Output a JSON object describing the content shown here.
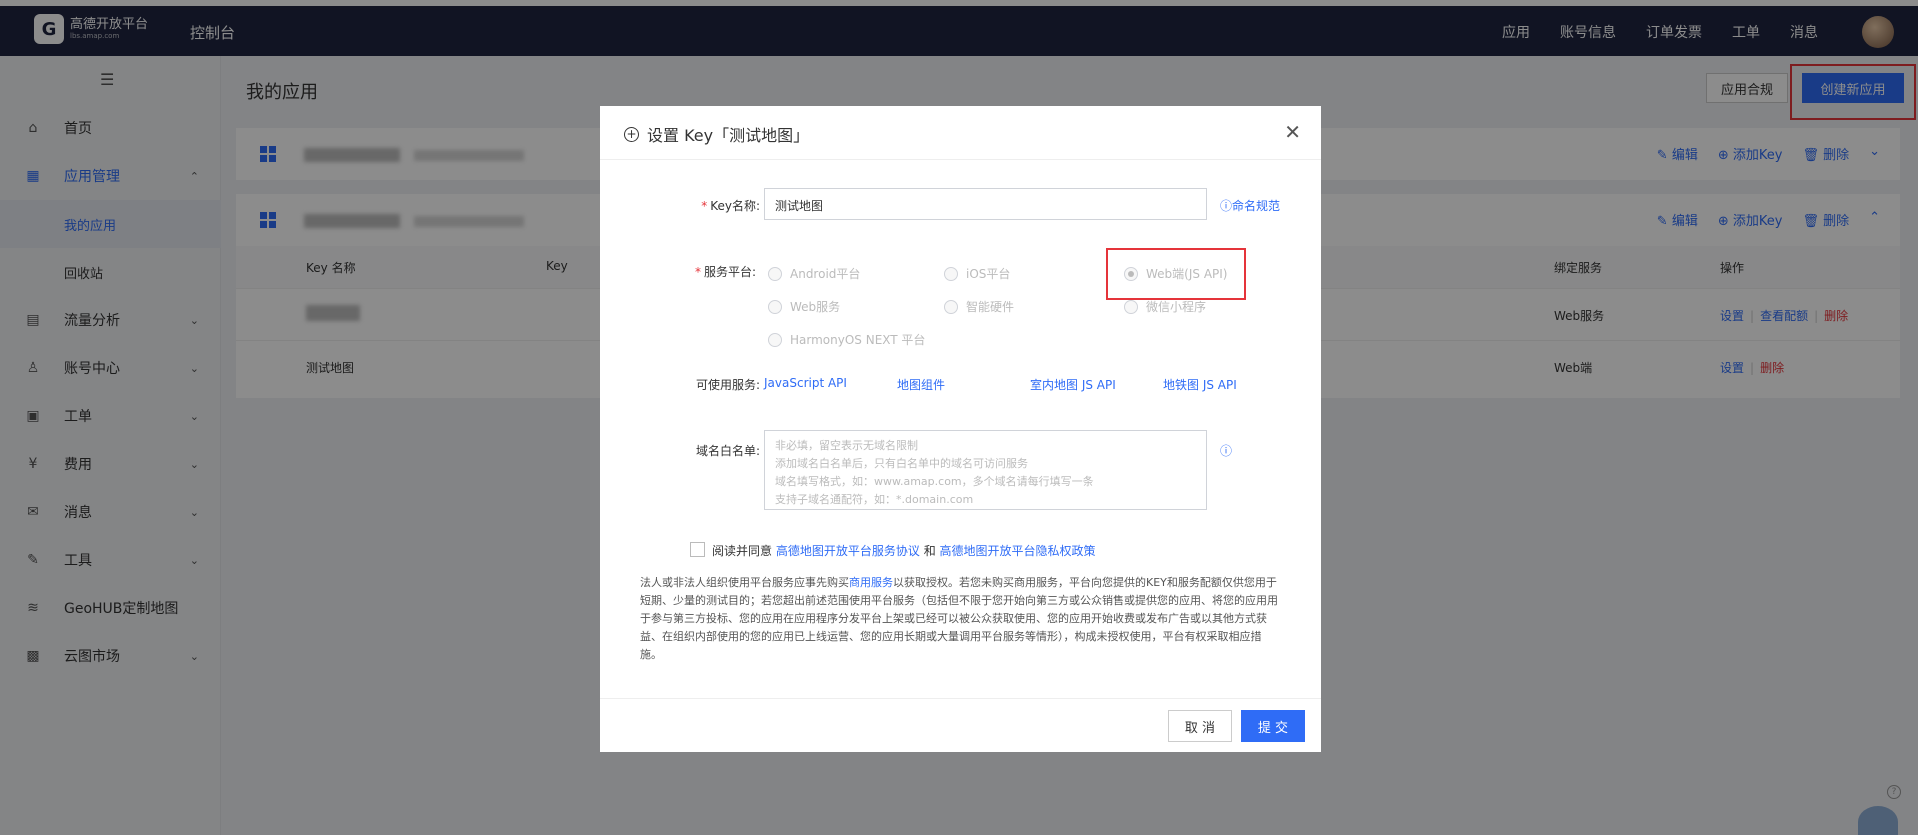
{
  "topbar": {
    "logo_mark": "G",
    "logo_name": "高德开放平台",
    "logo_domain": "lbs.amap.com",
    "console": "控制台",
    "nav": [
      "应用",
      "账号信息",
      "订单发票",
      "工单",
      "消息"
    ]
  },
  "sidebar": {
    "menu_icon": "☰",
    "items": [
      {
        "label": "首页",
        "icon": "home-icon",
        "glyph": "⌂"
      },
      {
        "label": "应用管理",
        "icon": "app-grid-icon",
        "glyph": "▦"
      },
      {
        "label": "流量分析",
        "icon": "chart-icon",
        "glyph": "▤"
      },
      {
        "label": "账号中心",
        "icon": "user-icon",
        "glyph": "♙"
      },
      {
        "label": "工单",
        "icon": "ticket-icon",
        "glyph": "▣"
      },
      {
        "label": "费用",
        "icon": "fee-icon",
        "glyph": "¥"
      },
      {
        "label": "消息",
        "icon": "message-icon",
        "glyph": "✉"
      },
      {
        "label": "工具",
        "icon": "wrench-icon",
        "glyph": "✎"
      },
      {
        "label": "GeoHUB定制地图",
        "icon": "layers-icon",
        "glyph": "≋"
      },
      {
        "label": "云图市场",
        "icon": "store-icon",
        "glyph": "▩"
      }
    ],
    "subitems": [
      "我的应用",
      "回收站"
    ]
  },
  "main": {
    "title": "我的应用",
    "btn_compliance": "应用合规",
    "btn_create": "创建新应用",
    "card_actions": {
      "edit": "编辑",
      "add_key": "添加Key",
      "delete": "删除"
    },
    "table_headers": {
      "key_name": "Key 名称",
      "key": "Key",
      "bound_service": "绑定服务",
      "actions": "操作"
    },
    "rows": [
      {
        "key_name": "",
        "service": "Web服务",
        "actions": [
          "设置",
          "查看配额",
          "删除"
        ]
      },
      {
        "key_name": "测试地图",
        "service": "Web端",
        "actions": [
          "设置",
          "删除"
        ]
      }
    ]
  },
  "modal": {
    "title": "设置 Key「测试地图」",
    "key_name_label": "Key名称:",
    "key_name_value": "测试地图",
    "naming_rule": "命名规范",
    "platform_label": "服务平台:",
    "platforms": [
      "Android平台",
      "iOS平台",
      "Web端(JS API)",
      "Web服务",
      "智能硬件",
      "微信小程序",
      "HarmonyOS NEXT 平台"
    ],
    "services_label": "可使用服务:",
    "services": [
      "JavaScript API",
      "地图组件",
      "室内地图 JS API",
      "地铁图 JS API"
    ],
    "domain_label": "域名白名单:",
    "domain_placeholder": [
      "非必填，留空表示无域名限制",
      "添加域名白名单后，只有白名单中的域名可访问服务",
      "域名填写格式，如：www.amap.com，多个域名请每行填写一条",
      "支持子域名通配符，如：*.domain.com"
    ],
    "agree_prefix": "阅读并同意",
    "agree_link1": "高德地图开放平台服务协议",
    "agree_and": "和",
    "agree_link2": "高德地图开放平台隐私权政策",
    "legal_before": "法人或非法人组织使用平台服务应事先购买",
    "legal_link": "商用服务",
    "legal_after": "以获取授权。若您未购买商用服务，平台向您提供的KEY和服务配额仅供您用于短期、少量的测试目的；若您超出前述范围使用平台服务（包括但不限于您开始向第三方或公众销售或提供您的应用、将您的应用用于参与第三方投标、您的应用在应用程序分发平台上架或已经可以被公众获取使用、您的应用开始收费或发布广告或以其他方式获益、在组织内部使用的您的应用已上线运营、您的应用长期或大量调用平台服务等情形），构成未授权使用，平台有权采取相应措施。",
    "btn_cancel": "取 消",
    "btn_submit": "提 交"
  },
  "colors": {
    "accent": "#2f6cf6",
    "danger": "#e5343a",
    "topbar": "#1f2540"
  }
}
